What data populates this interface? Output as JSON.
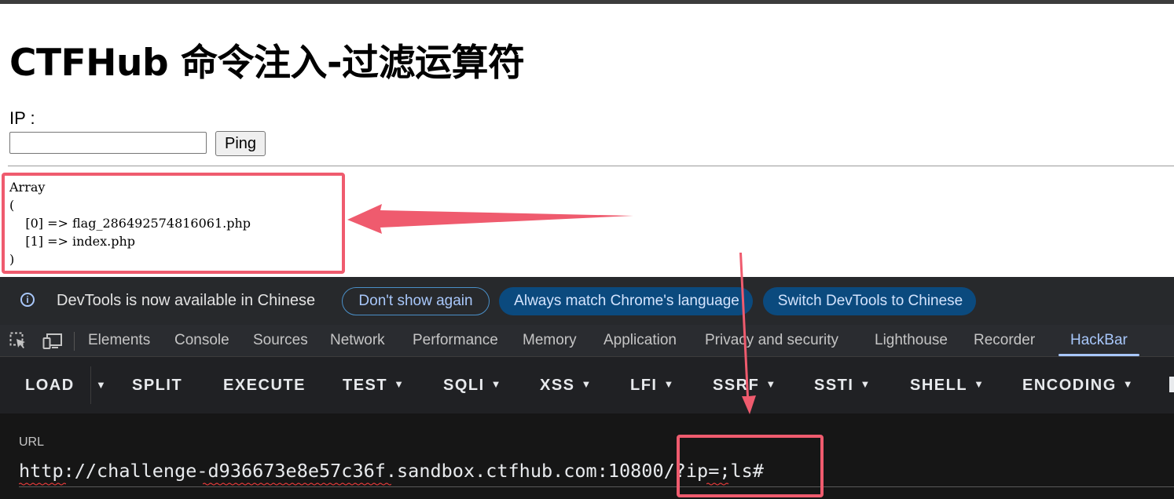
{
  "page": {
    "title": "CTFHub 命令注入-过滤运算符",
    "ip_label": "IP :",
    "ip_value": "",
    "ping_button": "Ping",
    "output": "Array\n(\n    [0] => flag_286492574816061.php\n    [1] => index.php\n)"
  },
  "banner": {
    "message": "DevTools is now available in Chinese",
    "dont_show": "Don't show again",
    "always_match": "Always match Chrome's language",
    "switch": "Switch DevTools to Chinese"
  },
  "tabs": [
    "Elements",
    "Console",
    "Sources",
    "Network",
    "Performance",
    "Memory",
    "Application",
    "Privacy and security",
    "Lighthouse",
    "Recorder",
    "HackBar"
  ],
  "active_tab": "HackBar",
  "hackbar": {
    "buttons": [
      "LOAD",
      "SPLIT",
      "EXECUTE",
      "TEST",
      "SQLI",
      "XSS",
      "LFI",
      "SSRF",
      "SSTI",
      "SHELL",
      "ENCODING"
    ],
    "url_label": "URL",
    "url_value": "http://challenge-d936673e8e57c36f.sandbox.ctfhub.com:10800/?ip=;ls#"
  },
  "colors": {
    "annotation": "#ef5b6e",
    "accent": "#a8c7fa",
    "pill_fill": "#0b4a7e",
    "devtools_bg": "#202124"
  },
  "icons": [
    "info-icon",
    "element-picker-icon",
    "device-toolbar-icon",
    "dropdown-caret-icon"
  ]
}
